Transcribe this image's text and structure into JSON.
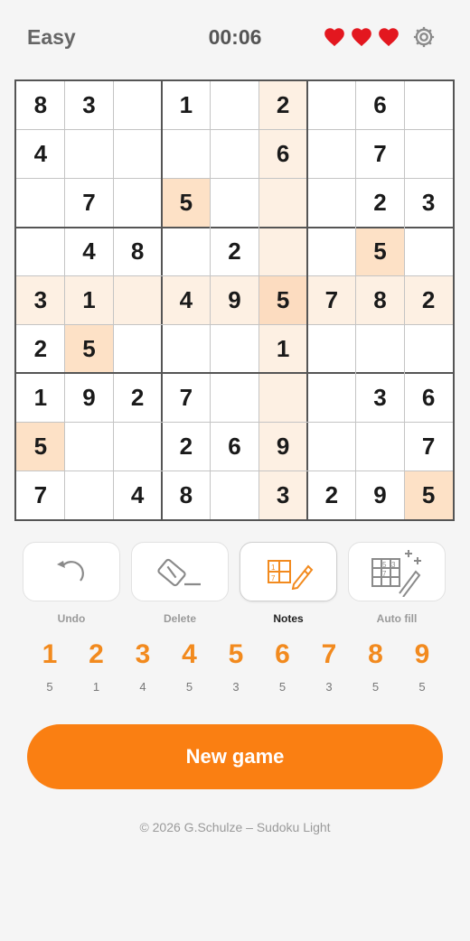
{
  "header": {
    "difficulty": "Easy",
    "timer": "00:06",
    "lives": 3,
    "heart_color": "#e3171f",
    "settings_icon": "gear-icon"
  },
  "board": {
    "givens": [
      [
        8,
        3,
        0,
        1,
        0,
        2,
        0,
        6,
        0
      ],
      [
        4,
        0,
        0,
        0,
        0,
        6,
        0,
        7,
        0
      ],
      [
        0,
        7,
        0,
        5,
        0,
        0,
        0,
        2,
        3
      ],
      [
        0,
        4,
        8,
        0,
        2,
        0,
        0,
        5,
        0
      ],
      [
        3,
        1,
        0,
        4,
        9,
        5,
        7,
        8,
        2
      ],
      [
        2,
        5,
        0,
        0,
        0,
        1,
        0,
        0,
        0
      ],
      [
        1,
        9,
        2,
        7,
        0,
        0,
        0,
        3,
        6
      ],
      [
        5,
        0,
        0,
        2,
        6,
        9,
        0,
        0,
        7
      ],
      [
        7,
        0,
        4,
        8,
        0,
        3,
        2,
        9,
        5
      ]
    ],
    "selected_cell": [
      4,
      5
    ],
    "highlight_value": 5,
    "colors": {
      "selected": "#fcdcc0",
      "same_value": "#fde1c6",
      "related": "#fdf0e3",
      "default": "#ffffff"
    }
  },
  "tools": [
    {
      "label": "Undo",
      "icon": "undo-icon",
      "active": false
    },
    {
      "label": "Delete",
      "icon": "eraser-icon",
      "active": false
    },
    {
      "label": "Notes",
      "icon": "notes-pencil-icon",
      "active": true
    },
    {
      "label": "Auto fill",
      "icon": "auto-fill-icon",
      "active": false
    }
  ],
  "numpad": [
    {
      "digit": "1",
      "remaining": "5"
    },
    {
      "digit": "2",
      "remaining": "1"
    },
    {
      "digit": "3",
      "remaining": "4"
    },
    {
      "digit": "4",
      "remaining": "5"
    },
    {
      "digit": "5",
      "remaining": "3"
    },
    {
      "digit": "6",
      "remaining": "5"
    },
    {
      "digit": "7",
      "remaining": "3"
    },
    {
      "digit": "8",
      "remaining": "5"
    },
    {
      "digit": "9",
      "remaining": "5"
    }
  ],
  "accent_color": "#fa7f12",
  "new_game_label": "New game",
  "footer": "© 2026 G.Schulze – Sudoku Light"
}
